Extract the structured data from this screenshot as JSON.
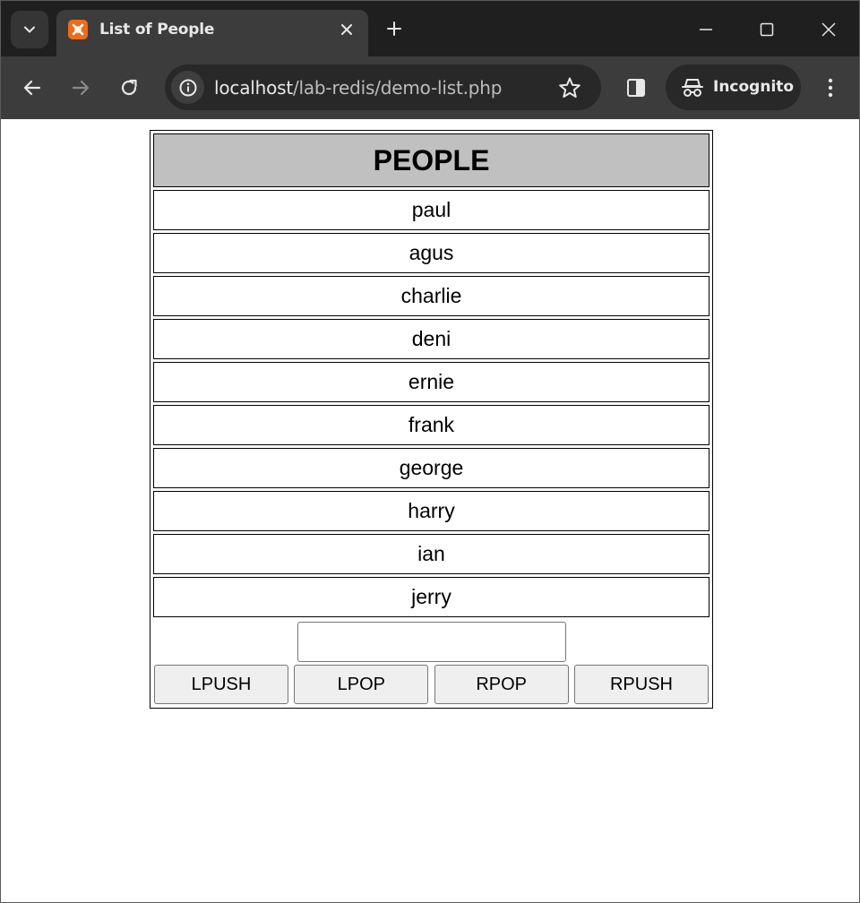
{
  "browser": {
    "tab": {
      "title": "List of People",
      "favicon": "xampp-icon"
    },
    "url": {
      "host": "localhost",
      "path": "/lab-redis/demo-list.php"
    },
    "profile_label": "Incognito"
  },
  "page": {
    "heading": "PEOPLE",
    "people": [
      "paul",
      "agus",
      "charlie",
      "deni",
      "ernie",
      "frank",
      "george",
      "harry",
      "ian",
      "jerry"
    ],
    "input": {
      "value": "",
      "placeholder": ""
    },
    "buttons": {
      "lpush": "LPUSH",
      "lpop": "LPOP",
      "rpop": "RPOP",
      "rpush": "RPUSH"
    }
  },
  "colors": {
    "header_bg": "#c0c0c0",
    "tab_favicon": "#ef6c1a",
    "chrome_dark": "#1f1f1f",
    "chrome_toolbar": "#3c3c3c"
  }
}
